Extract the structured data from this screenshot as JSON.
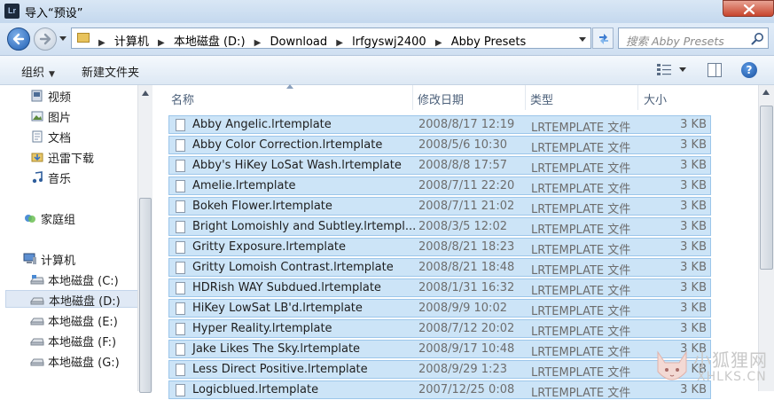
{
  "window": {
    "title": "导入“预设”",
    "app_icon_text": "Lr"
  },
  "address_bar": {
    "breadcrumbs": [
      "计算机",
      "本地磁盘 (D:)",
      "Download",
      "lrfgyswj2400",
      "Abby Presets"
    ],
    "search_placeholder": "搜索 Abby Presets"
  },
  "toolbar": {
    "organize_label": "组织",
    "new_folder_label": "新建文件夹"
  },
  "sidebar": {
    "libraries": [
      {
        "label": "视频",
        "icon": "video-library-icon"
      },
      {
        "label": "图片",
        "icon": "pictures-library-icon"
      },
      {
        "label": "文档",
        "icon": "documents-library-icon"
      },
      {
        "label": "迅雷下载",
        "icon": "xunlei-download-icon"
      },
      {
        "label": "音乐",
        "icon": "music-library-icon"
      }
    ],
    "homegroup": {
      "label": "家庭组",
      "icon": "homegroup-icon"
    },
    "computer": {
      "label": "计算机",
      "icon": "computer-icon",
      "drives": [
        {
          "label": "本地磁盘 (C:)",
          "selected": false
        },
        {
          "label": "本地磁盘 (D:)",
          "selected": true
        },
        {
          "label": "本地磁盘 (E:)",
          "selected": false
        },
        {
          "label": "本地磁盘 (F:)",
          "selected": false
        },
        {
          "label": "本地磁盘 (G:)",
          "selected": false
        }
      ]
    }
  },
  "columns": {
    "name": "名称",
    "date": "修改日期",
    "type": "类型",
    "size": "大小"
  },
  "files": [
    {
      "name": "Abby Angelic.lrtemplate",
      "date": "2008/8/17 12:19",
      "type": "LRTEMPLATE 文件",
      "size": "3 KB"
    },
    {
      "name": "Abby Color Correction.lrtemplate",
      "date": "2008/5/6 10:30",
      "type": "LRTEMPLATE 文件",
      "size": "3 KB"
    },
    {
      "name": "Abby's HiKey LoSat Wash.lrtemplate",
      "date": "2008/8/8 17:57",
      "type": "LRTEMPLATE 文件",
      "size": "3 KB"
    },
    {
      "name": "Amelie.lrtemplate",
      "date": "2008/7/11 22:20",
      "type": "LRTEMPLATE 文件",
      "size": "3 KB"
    },
    {
      "name": "Bokeh Flower.lrtemplate",
      "date": "2008/7/11 21:02",
      "type": "LRTEMPLATE 文件",
      "size": "3 KB"
    },
    {
      "name": "Bright Lomoishly and Subtley.lrtempl...",
      "date": "2008/3/5 12:02",
      "type": "LRTEMPLATE 文件",
      "size": "3 KB"
    },
    {
      "name": "Gritty Exposure.lrtemplate",
      "date": "2008/8/21 18:23",
      "type": "LRTEMPLATE 文件",
      "size": "3 KB"
    },
    {
      "name": "Gritty Lomoish Contrast.lrtemplate",
      "date": "2008/8/21 18:48",
      "type": "LRTEMPLATE 文件",
      "size": "3 KB"
    },
    {
      "name": "HDRish WAY Subdued.lrtemplate",
      "date": "2008/1/31 16:32",
      "type": "LRTEMPLATE 文件",
      "size": "3 KB"
    },
    {
      "name": "HiKey LowSat LB'd.lrtemplate",
      "date": "2008/9/9 10:02",
      "type": "LRTEMPLATE 文件",
      "size": "3 KB"
    },
    {
      "name": "Hyper Reality.lrtemplate",
      "date": "2008/7/12 20:02",
      "type": "LRTEMPLATE 文件",
      "size": "3 KB"
    },
    {
      "name": "Jake Likes The Sky.lrtemplate",
      "date": "2008/9/17 10:48",
      "type": "LRTEMPLATE 文件",
      "size": "3 KB"
    },
    {
      "name": "Less Direct Positive.lrtemplate",
      "date": "2008/9/29 1:23",
      "type": "LRTEMPLATE 文件",
      "size": "3 KB"
    },
    {
      "name": "Logicblued.lrtemplate",
      "date": "2007/12/25 0:08",
      "type": "LRTEMPLATE 文件",
      "size": "3 KB"
    }
  ],
  "watermark": {
    "cn": "小狐狸网",
    "en": "XHLKS.CN"
  },
  "colors": {
    "selection_fill": "#cce4f7",
    "selection_border": "#9cc6ea",
    "close_red": "#c7452d"
  }
}
